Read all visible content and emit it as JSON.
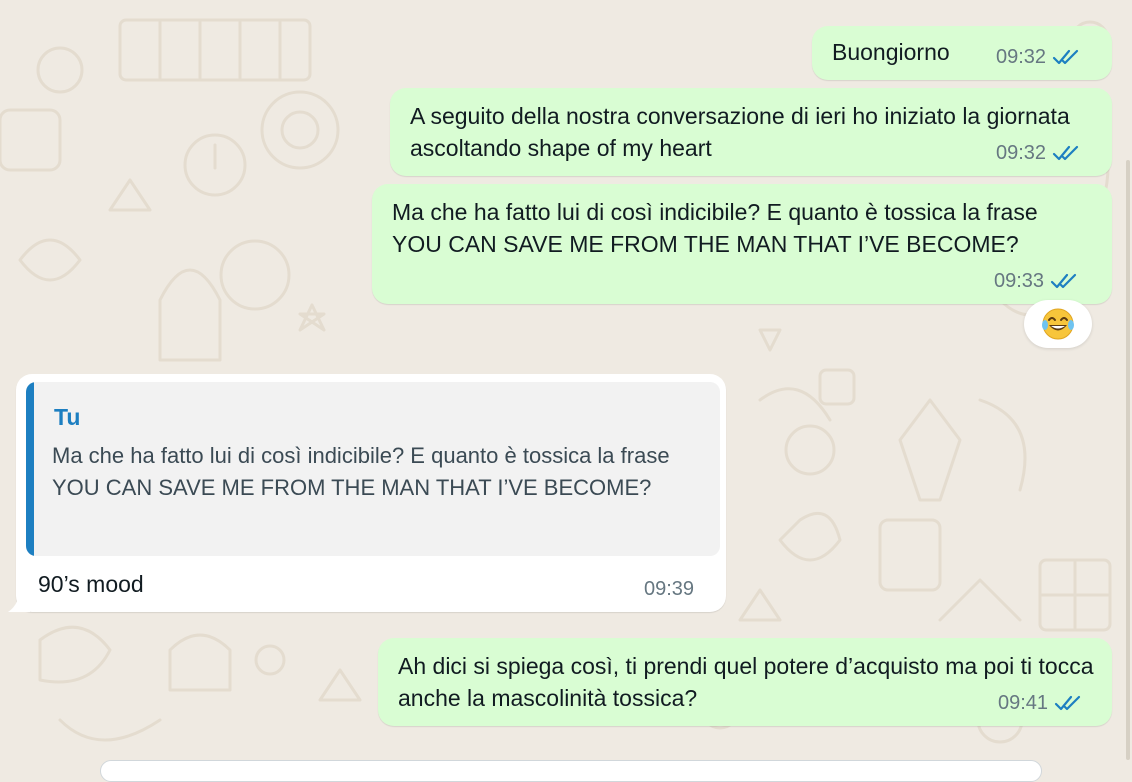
{
  "messages": [
    {
      "text": "Buongiorno",
      "time": "09:32"
    },
    {
      "text": "A seguito della nostra conversazione di ieri ho iniziato la giornata ascoltando shape of my heart",
      "time": "09:32"
    },
    {
      "text": "Ma che ha fatto lui di così indicibile? E quanto è tossica la frase YOU CAN SAVE ME FROM THE MAN THAT I’VE BECOME?",
      "time": "09:33",
      "reaction": "😂"
    },
    {
      "quote_author": "Tu",
      "quote_text": "Ma che ha fatto lui di così indicibile? E quanto è tossica la frase YOU CAN SAVE ME FROM THE MAN THAT I’VE BECOME?",
      "text": "90’s mood",
      "time": "09:39"
    },
    {
      "text": "Ah dici si spiega così, ti prendi quel potere d’acquisto ma poi ti tocca anche la mascolinità tossica?",
      "time": "09:41"
    }
  ],
  "icons": {
    "read_receipt": "double-check-icon",
    "read_color": "#1d7fc1"
  },
  "colors": {
    "background": "#efeae2",
    "outgoing_bubble": "#d9fdd3",
    "incoming_bubble": "#ffffff",
    "quote_accent": "#1d7fc1"
  }
}
